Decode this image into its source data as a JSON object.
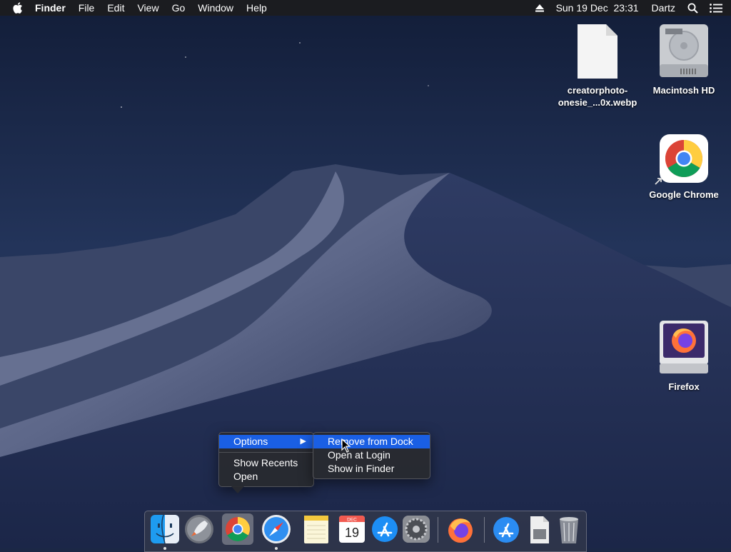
{
  "menubar": {
    "app_name": "Finder",
    "items": [
      "File",
      "Edit",
      "View",
      "Go",
      "Window",
      "Help"
    ],
    "datetime": "Sun 19 Dec  23:31",
    "user": "Dartz"
  },
  "desktop": {
    "icons": [
      {
        "label_line1": "creatorphoto-",
        "label_line2": "onesie_...0x.webp",
        "icon": "document-icon"
      },
      {
        "label": "Macintosh HD",
        "icon": "hard-drive-icon"
      },
      {
        "label": "Google Chrome",
        "icon": "chrome-icon"
      },
      {
        "label": "Firefox",
        "icon": "firefox-disk-icon"
      }
    ]
  },
  "context_menu": {
    "items": [
      {
        "label": "Options",
        "selected": true,
        "submenu": true
      },
      {
        "label": "Show Recents"
      },
      {
        "label": "Open"
      }
    ]
  },
  "submenu": {
    "items": [
      {
        "label": "Remove from Dock",
        "selected": true
      },
      {
        "label": "Open at Login"
      },
      {
        "label": "Show in Finder"
      }
    ]
  },
  "dock": {
    "items": [
      {
        "name": "Finder",
        "icon": "finder-icon",
        "running": true
      },
      {
        "name": "Launchpad",
        "icon": "rocket-icon"
      },
      {
        "name": "Google Chrome",
        "icon": "chrome-icon"
      },
      {
        "name": "Safari",
        "icon": "compass-icon",
        "running": true
      },
      {
        "name": "Notes",
        "icon": "notes-icon"
      },
      {
        "name": "Calendar",
        "icon": "calendar-icon",
        "month": "DEC",
        "day": "19"
      },
      {
        "name": "App Store",
        "icon": "app-store-icon"
      },
      {
        "name": "System Preferences",
        "icon": "gear-icon"
      },
      {
        "name": "Firefox",
        "icon": "firefox-icon"
      },
      {
        "name": "Applications",
        "icon": "applications-folder-icon"
      },
      {
        "name": "Downloads",
        "icon": "downloads-stack-icon"
      },
      {
        "name": "Trash",
        "icon": "trash-icon"
      }
    ]
  },
  "colors": {
    "selection": "#1a5fe4",
    "menubar": "#1c1c1e"
  }
}
